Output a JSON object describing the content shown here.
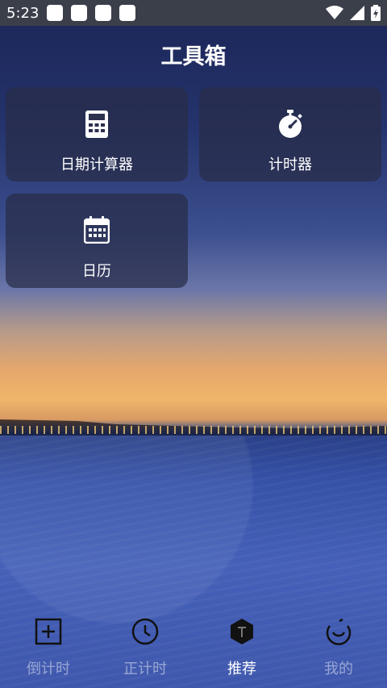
{
  "status_bar": {
    "time": "5:23"
  },
  "header": {
    "title": "工具箱"
  },
  "tools": [
    {
      "label": "日期计算器",
      "icon": "calculator-icon"
    },
    {
      "label": "计时器",
      "icon": "stopwatch-icon"
    },
    {
      "label": "日历",
      "icon": "calendar-icon"
    }
  ],
  "tabs": [
    {
      "label": "倒计时",
      "icon": "add-box-icon",
      "active": false
    },
    {
      "label": "正计时",
      "icon": "clock-icon",
      "active": false
    },
    {
      "label": "推荐",
      "icon": "hexagon-t-icon",
      "active": true
    },
    {
      "label": "我的",
      "icon": "profile-icon",
      "active": false
    }
  ]
}
